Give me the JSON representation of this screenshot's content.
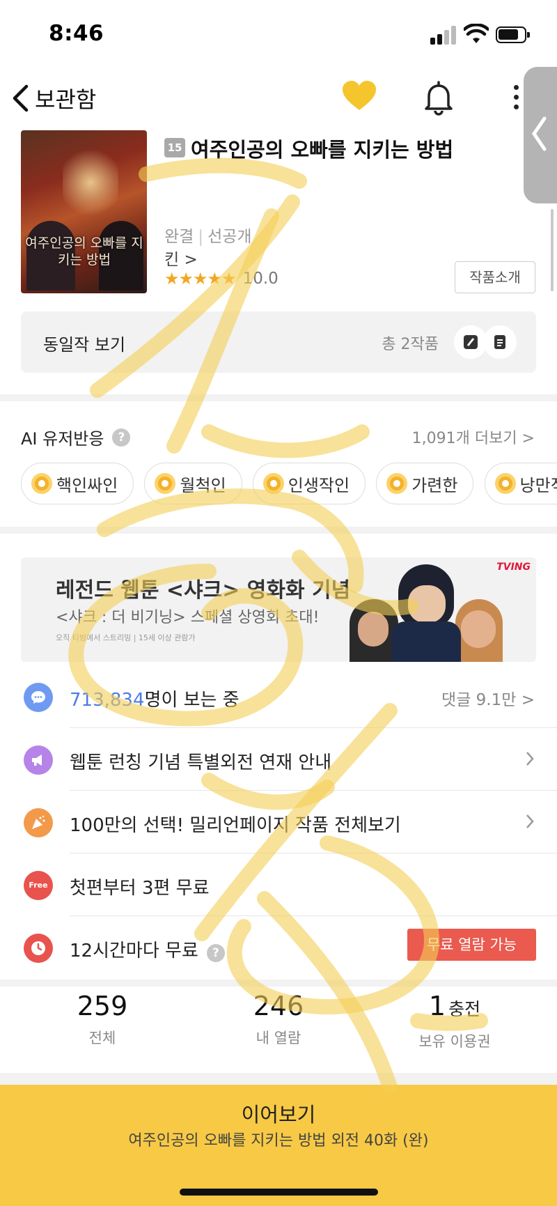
{
  "status_bar": {
    "time": "8:46"
  },
  "nav": {
    "back_label": "보관함"
  },
  "work": {
    "cover_title": "여주인공의 오빠를 지키는 방법",
    "age_rating": "15",
    "title": "여주인공의 오빠를 지키는 방법",
    "status_complete": "완결",
    "status_preview": "선공개",
    "author": "킨 >",
    "stars": "★★★★★",
    "rating": "10.0",
    "intro_button": "작품소개"
  },
  "same_work": {
    "label": "동일작 보기",
    "count": "총 2작품"
  },
  "ai_reactions": {
    "title": "AI 유저반응",
    "help": "?",
    "more": "1,091개 더보기 >",
    "chips": [
      "핵인싸인",
      "월척인",
      "인생작인",
      "가련한",
      "낭만적"
    ]
  },
  "banner": {
    "headline": "레전드 웹툰 <샤크> 영화화 기념",
    "subline": "<샤크 : 더 비기닝> 스페셜 상영회 초대!",
    "fine_print": "오직 티빙에서 스트리밍 | 15세 이상 관람가",
    "brand": "TVING"
  },
  "info_rows": {
    "viewers_count": "713,834",
    "viewers_suffix": "명이 보는 중",
    "comments": "댓글 9.1만 >",
    "notice": "웹툰 런칭 기념 특별외전 연재 안내",
    "promo": "100만의 선택! 밀리언페이지 작품 전체보기",
    "free_badge": "Free",
    "free_first": "첫편부터 3편 무료",
    "wait_free": "12시간마다 무료",
    "wait_help": "?",
    "wait_button": "무료 열람 가능"
  },
  "stats": {
    "total_num": "259",
    "total_cap": "전체",
    "opened_num": "246",
    "opened_cap": "내 열람",
    "ticket_num": "1",
    "ticket_charge": "충전",
    "ticket_cap": "보유 이용권"
  },
  "cta": {
    "label": "이어보기",
    "episode": "여주인공의 오빠를 지키는 방법 외전 40화 (완)"
  },
  "colors": {
    "accent": "#f7c945",
    "heart": "#f5c52e",
    "free_button": "#ea5a4f",
    "highlight_blue": "#4b7be5"
  },
  "icons": [
    "chevron-left-icon",
    "heart-icon",
    "bell-icon",
    "more-icon",
    "comment-icon",
    "megaphone-icon",
    "party-popper-icon",
    "free-icon",
    "clock-icon",
    "coin-icon",
    "grid-view-icon",
    "list-view-icon"
  ]
}
